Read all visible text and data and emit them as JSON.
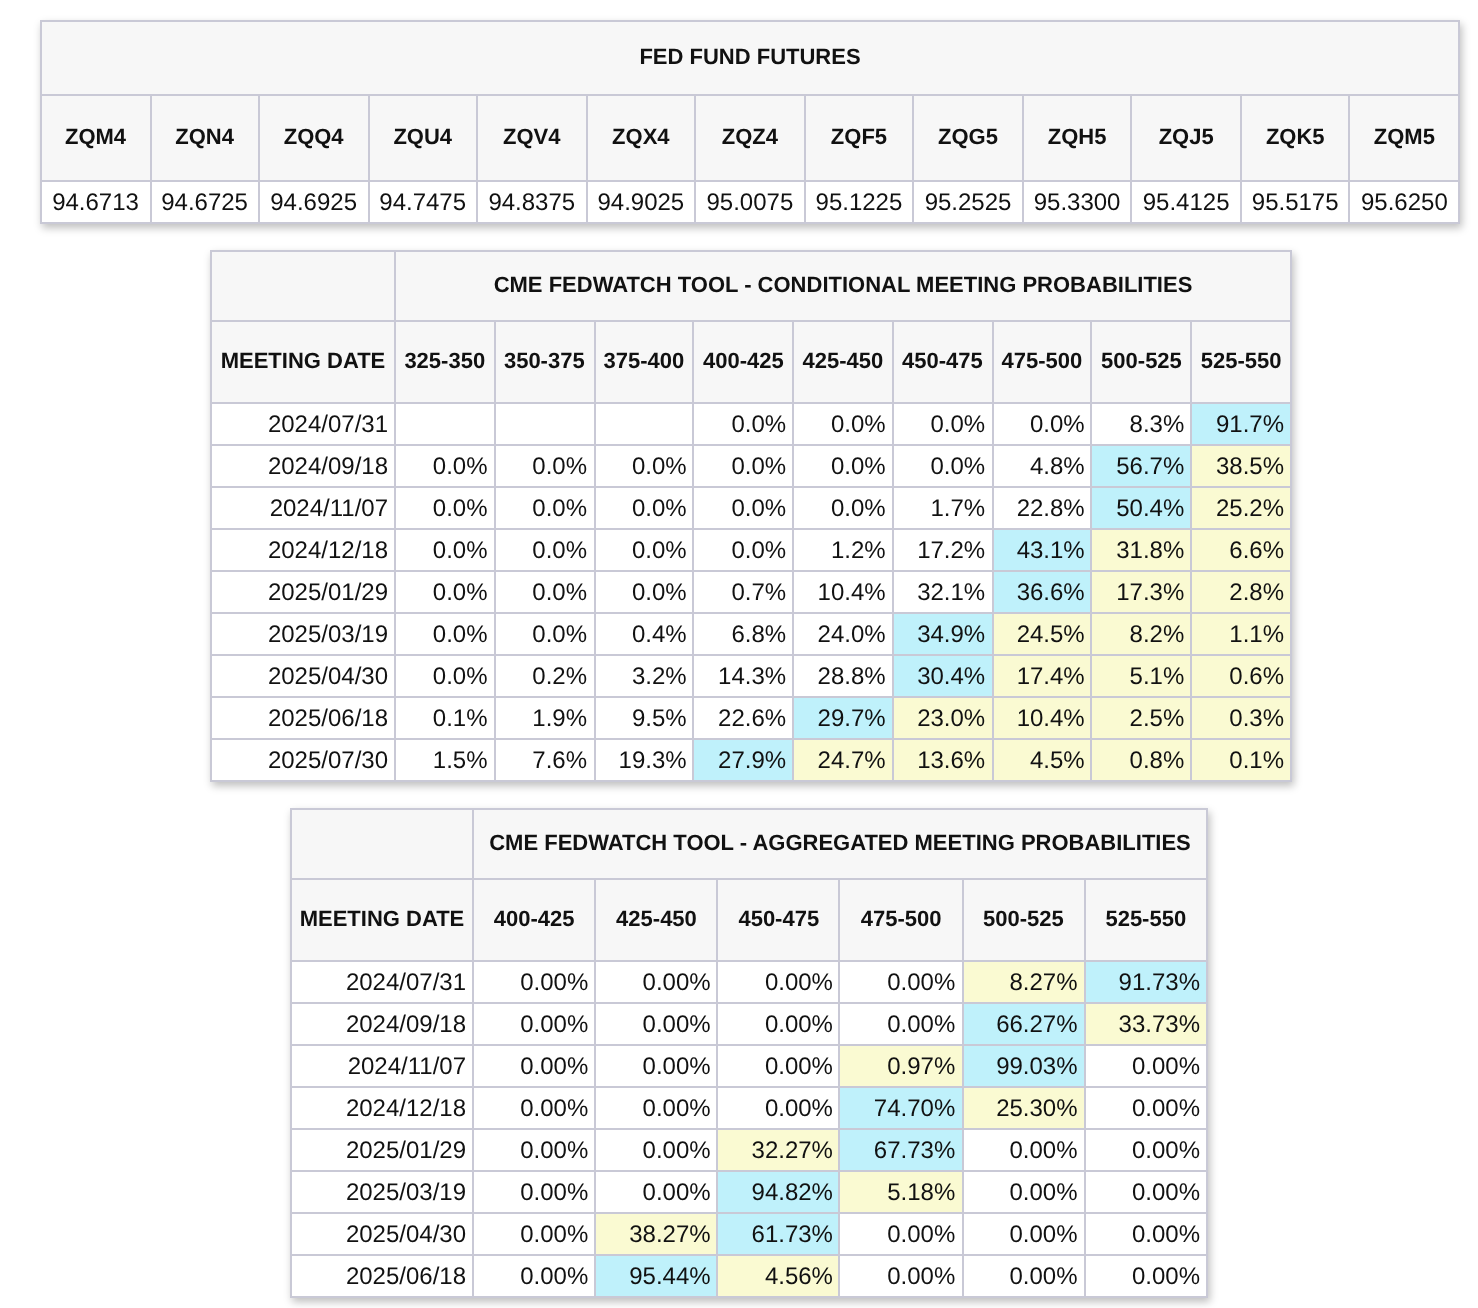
{
  "futures": {
    "title": "FED FUND FUTURES",
    "columns": [
      "ZQM4",
      "ZQN4",
      "ZQQ4",
      "ZQU4",
      "ZQV4",
      "ZQX4",
      "ZQZ4",
      "ZQF5",
      "ZQG5",
      "ZQH5",
      "ZQJ5",
      "ZQK5",
      "ZQM5"
    ],
    "values": [
      "94.6713",
      "94.6725",
      "94.6925",
      "94.7475",
      "94.8375",
      "94.9025",
      "95.0075",
      "95.1225",
      "95.2525",
      "95.3300",
      "95.4125",
      "95.5175",
      "95.6250"
    ]
  },
  "conditional": {
    "title": "CME FEDWATCH TOOL - CONDITIONAL MEETING PROBABILITIES",
    "date_header": "MEETING DATE",
    "columns": [
      "325-350",
      "350-375",
      "375-400",
      "400-425",
      "425-450",
      "450-475",
      "475-500",
      "500-525",
      "525-550"
    ],
    "rows": [
      {
        "date": "2024/07/31",
        "cells": [
          null,
          null,
          null,
          {
            "text": "0.0%"
          },
          {
            "text": "0.0%"
          },
          {
            "text": "0.0%"
          },
          {
            "text": "0.0%"
          },
          {
            "text": "8.3%"
          },
          {
            "text": "91.7%",
            "color": "#bff1fb"
          }
        ]
      },
      {
        "date": "2024/09/18",
        "cells": [
          {
            "text": "0.0%"
          },
          {
            "text": "0.0%"
          },
          {
            "text": "0.0%"
          },
          {
            "text": "0.0%"
          },
          {
            "text": "0.0%"
          },
          {
            "text": "0.0%"
          },
          {
            "text": "4.8%"
          },
          {
            "text": "56.7%",
            "color": "#bff1fb"
          },
          {
            "text": "38.5%",
            "color": "#fafad2"
          }
        ]
      },
      {
        "date": "2024/11/07",
        "cells": [
          {
            "text": "0.0%"
          },
          {
            "text": "0.0%"
          },
          {
            "text": "0.0%"
          },
          {
            "text": "0.0%"
          },
          {
            "text": "0.0%"
          },
          {
            "text": "1.7%"
          },
          {
            "text": "22.8%"
          },
          {
            "text": "50.4%",
            "color": "#bff1fb"
          },
          {
            "text": "25.2%",
            "color": "#fafad2"
          }
        ]
      },
      {
        "date": "2024/12/18",
        "cells": [
          {
            "text": "0.0%"
          },
          {
            "text": "0.0%"
          },
          {
            "text": "0.0%"
          },
          {
            "text": "0.0%"
          },
          {
            "text": "1.2%"
          },
          {
            "text": "17.2%"
          },
          {
            "text": "43.1%",
            "color": "#bff1fb"
          },
          {
            "text": "31.8%",
            "color": "#fafad2"
          },
          {
            "text": "6.6%",
            "color": "#fafad2"
          }
        ]
      },
      {
        "date": "2025/01/29",
        "cells": [
          {
            "text": "0.0%"
          },
          {
            "text": "0.0%"
          },
          {
            "text": "0.0%"
          },
          {
            "text": "0.7%"
          },
          {
            "text": "10.4%"
          },
          {
            "text": "32.1%"
          },
          {
            "text": "36.6%",
            "color": "#bff1fb"
          },
          {
            "text": "17.3%",
            "color": "#fafad2"
          },
          {
            "text": "2.8%",
            "color": "#fafad2"
          }
        ]
      },
      {
        "date": "2025/03/19",
        "cells": [
          {
            "text": "0.0%"
          },
          {
            "text": "0.0%"
          },
          {
            "text": "0.4%"
          },
          {
            "text": "6.8%"
          },
          {
            "text": "24.0%"
          },
          {
            "text": "34.9%",
            "color": "#bff1fb"
          },
          {
            "text": "24.5%",
            "color": "#fafad2"
          },
          {
            "text": "8.2%",
            "color": "#fafad2"
          },
          {
            "text": "1.1%",
            "color": "#fafad2"
          }
        ]
      },
      {
        "date": "2025/04/30",
        "cells": [
          {
            "text": "0.0%"
          },
          {
            "text": "0.2%"
          },
          {
            "text": "3.2%"
          },
          {
            "text": "14.3%"
          },
          {
            "text": "28.8%"
          },
          {
            "text": "30.4%",
            "color": "#bff1fb"
          },
          {
            "text": "17.4%",
            "color": "#fafad2"
          },
          {
            "text": "5.1%",
            "color": "#fafad2"
          },
          {
            "text": "0.6%",
            "color": "#fafad2"
          }
        ]
      },
      {
        "date": "2025/06/18",
        "cells": [
          {
            "text": "0.1%"
          },
          {
            "text": "1.9%"
          },
          {
            "text": "9.5%"
          },
          {
            "text": "22.6%"
          },
          {
            "text": "29.7%",
            "color": "#bff1fb"
          },
          {
            "text": "23.0%",
            "color": "#fafad2"
          },
          {
            "text": "10.4%",
            "color": "#fafad2"
          },
          {
            "text": "2.5%",
            "color": "#fafad2"
          },
          {
            "text": "0.3%",
            "color": "#fafad2"
          }
        ]
      },
      {
        "date": "2025/07/30",
        "cells": [
          {
            "text": "1.5%"
          },
          {
            "text": "7.6%"
          },
          {
            "text": "19.3%"
          },
          {
            "text": "27.9%",
            "color": "#bff1fb"
          },
          {
            "text": "24.7%",
            "color": "#fafad2"
          },
          {
            "text": "13.6%",
            "color": "#fafad2"
          },
          {
            "text": "4.5%",
            "color": "#fafad2"
          },
          {
            "text": "0.8%",
            "color": "#fafad2"
          },
          {
            "text": "0.1%",
            "color": "#fafad2"
          }
        ]
      }
    ]
  },
  "aggregated": {
    "title": "CME FEDWATCH TOOL - AGGREGATED MEETING PROBABILITIES",
    "date_header": "MEETING DATE",
    "columns": [
      "400-425",
      "425-450",
      "450-475",
      "475-500",
      "500-525",
      "525-550"
    ],
    "rows": [
      {
        "date": "2024/07/31",
        "cells": [
          {
            "text": "0.00%"
          },
          {
            "text": "0.00%"
          },
          {
            "text": "0.00%"
          },
          {
            "text": "0.00%"
          },
          {
            "text": "8.27%",
            "color": "#fafad2"
          },
          {
            "text": "91.73%",
            "color": "#bff1fb"
          }
        ]
      },
      {
        "date": "2024/09/18",
        "cells": [
          {
            "text": "0.00%"
          },
          {
            "text": "0.00%"
          },
          {
            "text": "0.00%"
          },
          {
            "text": "0.00%"
          },
          {
            "text": "66.27%",
            "color": "#bff1fb"
          },
          {
            "text": "33.73%",
            "color": "#fafad2"
          }
        ]
      },
      {
        "date": "2024/11/07",
        "cells": [
          {
            "text": "0.00%"
          },
          {
            "text": "0.00%"
          },
          {
            "text": "0.00%"
          },
          {
            "text": "0.97%",
            "color": "#fafad2"
          },
          {
            "text": "99.03%",
            "color": "#bff1fb"
          },
          {
            "text": "0.00%"
          }
        ]
      },
      {
        "date": "2024/12/18",
        "cells": [
          {
            "text": "0.00%"
          },
          {
            "text": "0.00%"
          },
          {
            "text": "0.00%"
          },
          {
            "text": "74.70%",
            "color": "#bff1fb"
          },
          {
            "text": "25.30%",
            "color": "#fafad2"
          },
          {
            "text": "0.00%"
          }
        ]
      },
      {
        "date": "2025/01/29",
        "cells": [
          {
            "text": "0.00%"
          },
          {
            "text": "0.00%"
          },
          {
            "text": "32.27%",
            "color": "#fafad2"
          },
          {
            "text": "67.73%",
            "color": "#bff1fb"
          },
          {
            "text": "0.00%"
          },
          {
            "text": "0.00%"
          }
        ]
      },
      {
        "date": "2025/03/19",
        "cells": [
          {
            "text": "0.00%"
          },
          {
            "text": "0.00%"
          },
          {
            "text": "94.82%",
            "color": "#bff1fb"
          },
          {
            "text": "5.18%",
            "color": "#fafad2"
          },
          {
            "text": "0.00%"
          },
          {
            "text": "0.00%"
          }
        ]
      },
      {
        "date": "2025/04/30",
        "cells": [
          {
            "text": "0.00%"
          },
          {
            "text": "38.27%",
            "color": "#fafad2"
          },
          {
            "text": "61.73%",
            "color": "#bff1fb"
          },
          {
            "text": "0.00%"
          },
          {
            "text": "0.00%"
          },
          {
            "text": "0.00%"
          }
        ]
      },
      {
        "date": "2025/06/18",
        "cells": [
          {
            "text": "0.00%"
          },
          {
            "text": "95.44%",
            "color": "#bff1fb"
          },
          {
            "text": "4.56%",
            "color": "#fafad2"
          },
          {
            "text": "0.00%"
          },
          {
            "text": "0.00%"
          },
          {
            "text": "0.00%"
          }
        ]
      }
    ]
  }
}
